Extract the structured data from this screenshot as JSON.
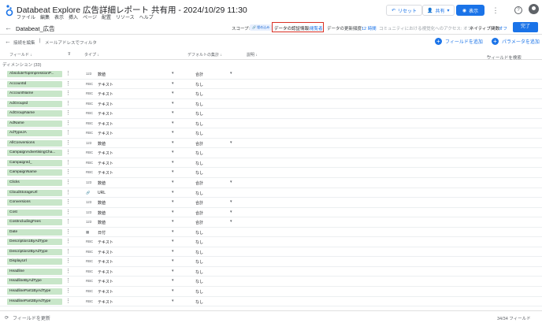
{
  "header": {
    "title": "Databeat Explore 広告詳細レポート 共有用 - 2024/10/29 11:30",
    "menu": [
      "ファイル",
      "編集",
      "表示",
      "挿入",
      "ページ",
      "配置",
      "リソース",
      "ヘルプ"
    ],
    "reset_label": "リセット",
    "share_label": "共有",
    "view_label": "表示"
  },
  "datasource": {
    "name": "Databeat_広告",
    "scope_label": "スコープ:",
    "scope_value": "🔗 埋め込み",
    "cred_label": "データの認証情報:",
    "cred_value": "閲覧者",
    "freshness_label": "データの更新頻度:",
    "freshness_value": "12 時間",
    "community_label": "コミュニティにおける視覚化へのアクセス: オフ",
    "native_label": "ネイティブ関数:",
    "native_value": "オフ",
    "done_label": "完了"
  },
  "toolbar": {
    "edit_connection": "接続を編集",
    "separator": "|",
    "email_filter": "メールアドレスでフィルタ",
    "add_field": "フィールドを追加",
    "add_parameter": "パラメータを追加"
  },
  "columns": {
    "field": "フィールド ↓",
    "type": "タイプ ↓",
    "aggregation": "デフォルトの集計 ↓",
    "description": "説明 ↓",
    "search_placeholder": "フィールドを検索"
  },
  "dimension_section": "ディメンション (33)",
  "rows": [
    {
      "name": "AbsoluteTopImpressionP...",
      "code": "123",
      "type": "数値",
      "agg": "合計",
      "agg_dd": true
    },
    {
      "name": "AccountId",
      "code": "RBC",
      "type": "テキスト",
      "agg": "なし",
      "agg_dd": false
    },
    {
      "name": "AccountName",
      "code": "RBC",
      "type": "テキスト",
      "agg": "なし",
      "agg_dd": false
    },
    {
      "name": "AdGroupId",
      "code": "RBC",
      "type": "テキスト",
      "agg": "なし",
      "agg_dd": false
    },
    {
      "name": "AdGroupName",
      "code": "RBC",
      "type": "テキスト",
      "agg": "なし",
      "agg_dd": false
    },
    {
      "name": "AdName",
      "code": "RBC",
      "type": "テキスト",
      "agg": "なし",
      "agg_dd": false
    },
    {
      "name": "AdTypeJA",
      "code": "RBC",
      "type": "テキスト",
      "agg": "なし",
      "agg_dd": false
    },
    {
      "name": "AllConversions",
      "code": "123",
      "type": "数値",
      "agg": "合計",
      "agg_dd": true
    },
    {
      "name": "CampaignAdvertisingCha...",
      "code": "RBC",
      "type": "テキスト",
      "agg": "なし",
      "agg_dd": false
    },
    {
      "name": "CampaignId_",
      "code": "RBC",
      "type": "テキスト",
      "agg": "なし",
      "agg_dd": false
    },
    {
      "name": "CampaignName",
      "code": "RBC",
      "type": "テキスト",
      "agg": "なし",
      "agg_dd": false
    },
    {
      "name": "Clicks",
      "code": "123",
      "type": "数値",
      "agg": "合計",
      "agg_dd": true
    },
    {
      "name": "CloudStorageUrl",
      "code": "🔗",
      "type": "URL",
      "agg": "なし",
      "agg_dd": false
    },
    {
      "name": "Conversions",
      "code": "123",
      "type": "数値",
      "agg": "合計",
      "agg_dd": true
    },
    {
      "name": "Cost",
      "code": "123",
      "type": "数値",
      "agg": "合計",
      "agg_dd": true
    },
    {
      "name": "CostIncludingFees",
      "code": "123",
      "type": "数値",
      "agg": "合計",
      "agg_dd": true
    },
    {
      "name": "Date",
      "code": "▦",
      "type": "日付",
      "agg": "なし",
      "agg_dd": false
    },
    {
      "name": "Description1ByAdType",
      "code": "RBC",
      "type": "テキスト",
      "agg": "なし",
      "agg_dd": false
    },
    {
      "name": "Description2ByAdType",
      "code": "RBC",
      "type": "テキスト",
      "agg": "なし",
      "agg_dd": false
    },
    {
      "name": "DisplayUrl",
      "code": "RBC",
      "type": "テキスト",
      "agg": "なし",
      "agg_dd": false
    },
    {
      "name": "Headline",
      "code": "RBC",
      "type": "テキスト",
      "agg": "なし",
      "agg_dd": false
    },
    {
      "name": "HeadlineByAdType",
      "code": "RBC",
      "type": "テキスト",
      "agg": "なし",
      "agg_dd": false
    },
    {
      "name": "HeadlinePart1ByAdType",
      "code": "RBC",
      "type": "テキスト",
      "agg": "なし",
      "agg_dd": false
    },
    {
      "name": "HeadlinePart2ByAdType",
      "code": "RBC",
      "type": "テキスト",
      "agg": "なし",
      "agg_dd": false
    }
  ],
  "footer": {
    "refresh_label": "フィールドを更新",
    "count": "34/34 フィールド"
  },
  "colors": {
    "accent": "#1a73e8",
    "pill_bg": "#c8e6c9",
    "highlight_border": "#d93025"
  }
}
